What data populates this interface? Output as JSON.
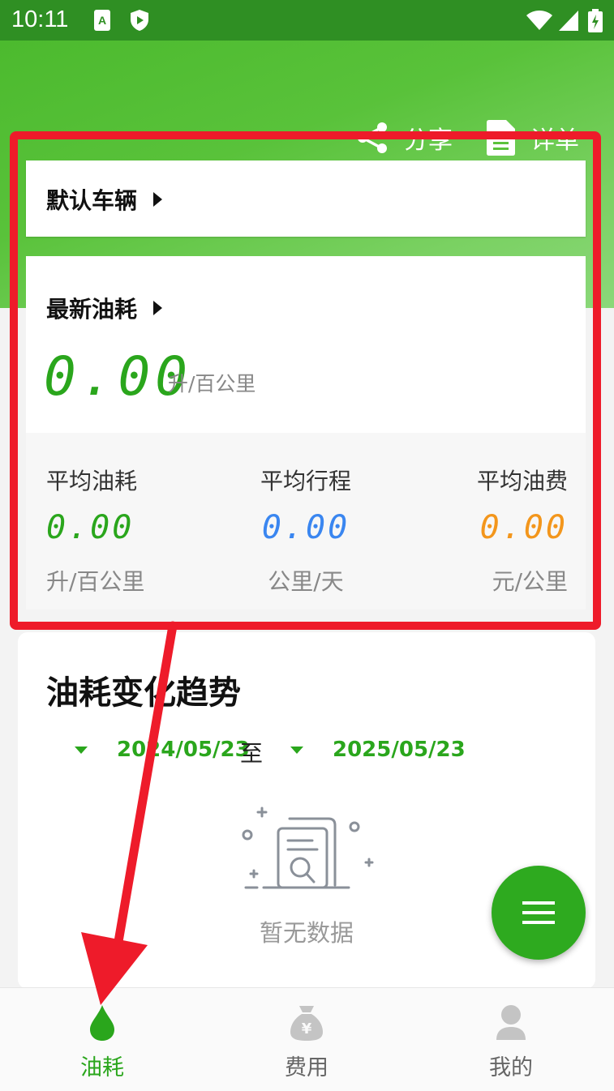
{
  "status_bar": {
    "time": "10:11"
  },
  "header": {
    "share_label": "分享",
    "detail_label": "详单"
  },
  "vehicle": {
    "label": "默认车辆"
  },
  "latest": {
    "label": "最新油耗",
    "value": "0.00",
    "unit": "升/百公里"
  },
  "averages": [
    {
      "title": "平均油耗",
      "value": "0.00",
      "unit": "升/百公里",
      "color": "#2aa61c"
    },
    {
      "title": "平均行程",
      "value": "0.00",
      "unit": "公里/天",
      "color": "#3a86f0"
    },
    {
      "title": "平均油费",
      "value": "0.00",
      "unit": "元/公里",
      "color": "#f3961c"
    }
  ],
  "trend": {
    "title": "油耗变化趋势",
    "start_date": "2024/05/23",
    "separator": "至",
    "end_date": "2025/05/23",
    "empty_text": "暂无数据"
  },
  "nav": {
    "items": [
      {
        "label": "油耗",
        "icon": "drop-icon",
        "active": true
      },
      {
        "label": "费用",
        "icon": "money-bag-icon",
        "active": false
      },
      {
        "label": "我的",
        "icon": "user-icon",
        "active": false
      }
    ]
  },
  "colors": {
    "primary": "#2aa61c",
    "annotation": "#ee1b2a"
  }
}
